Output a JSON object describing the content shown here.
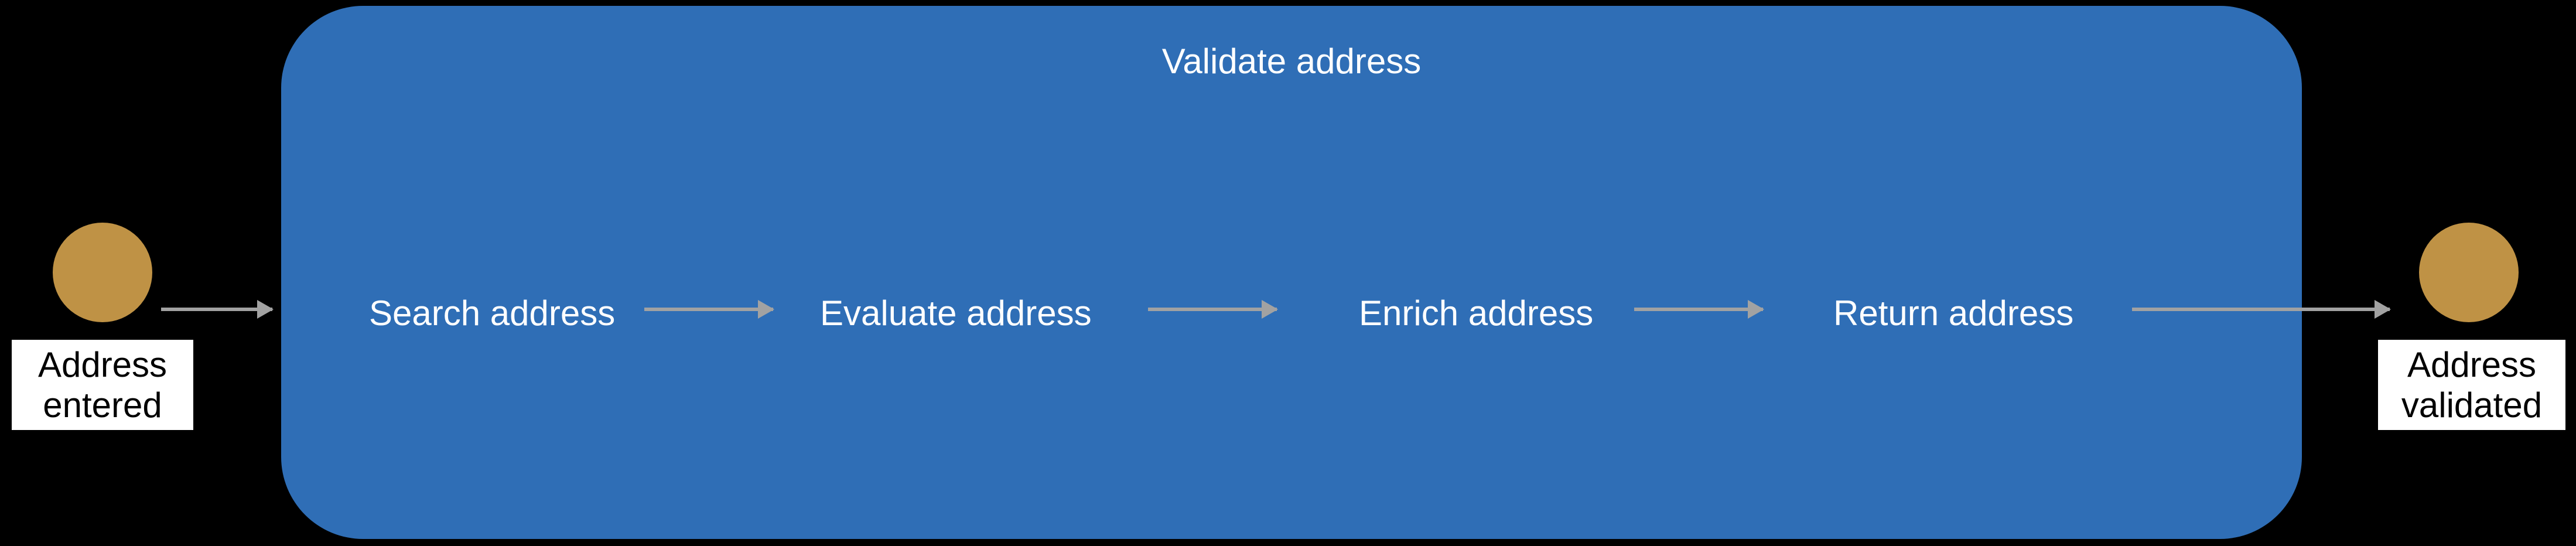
{
  "diagram": {
    "title": "Validate address",
    "start_event": {
      "label_line1": "Address",
      "label_line2": "entered"
    },
    "end_event": {
      "label_line1": "Address",
      "label_line2": "validated"
    },
    "steps": [
      "Search address",
      "Evaluate address",
      "Enrich address",
      "Return address"
    ]
  },
  "chart_data": {
    "type": "flow",
    "container_label": "Validate address",
    "start": "Address entered",
    "end": "Address validated",
    "sequence": [
      "Search address",
      "Evaluate address",
      "Enrich address",
      "Return address"
    ]
  }
}
